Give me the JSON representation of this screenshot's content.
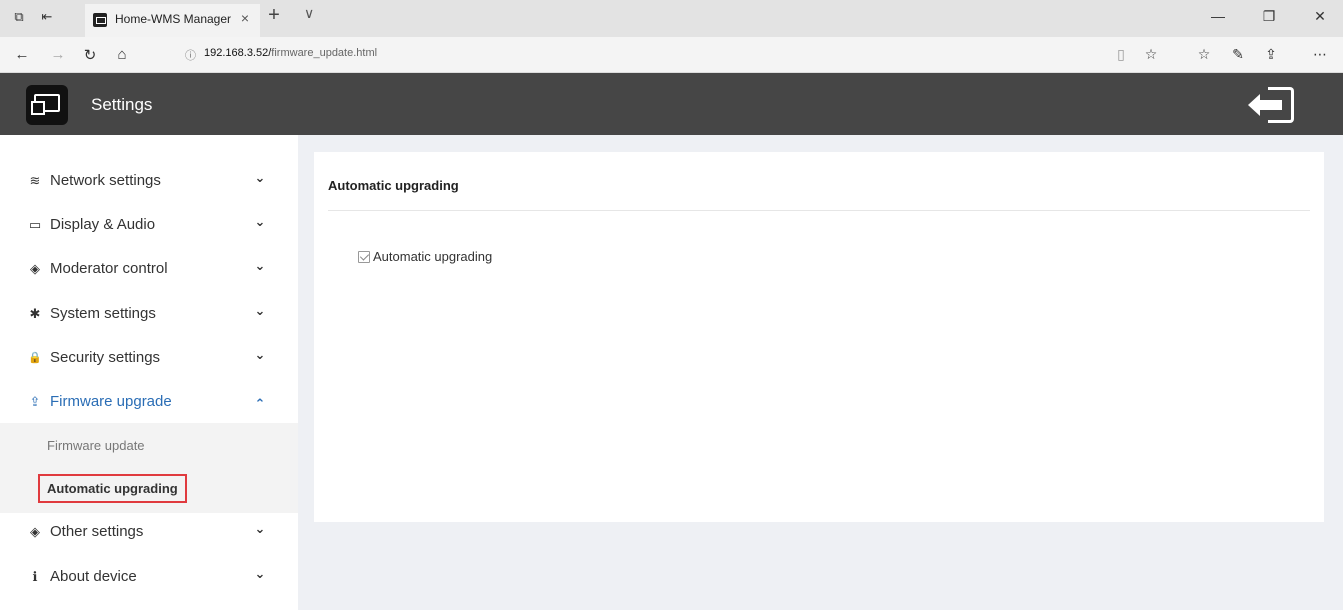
{
  "browser": {
    "tab_title": "Home-WMS Manager",
    "tab_close": "×",
    "new_tab": "+",
    "tab_list": "∨",
    "url_host": "192.168.3.52/",
    "url_path": "firmware_update.html",
    "window_controls": {
      "minimize": "—",
      "restore": "❐",
      "close": "✕"
    },
    "icons": [
      "tab-actions-icon",
      "set-aside-tabs-icon",
      "back-icon",
      "forward-icon",
      "refresh-icon",
      "home-icon",
      "site-info-icon",
      "reading-view-icon",
      "favorite-star-icon",
      "favorites-list-icon",
      "web-note-icon",
      "share-icon",
      "more-icon"
    ]
  },
  "header": {
    "title": "Settings",
    "logo_icon": "screen-mirror-icon",
    "logout_icon": "logout-icon"
  },
  "sidebar": {
    "items": [
      {
        "label": "Network settings",
        "icon": "wifi-icon",
        "glyph": "≋",
        "chevron": "⌄"
      },
      {
        "label": "Display & Audio",
        "icon": "monitor-icon",
        "glyph": "▭",
        "chevron": "⌄"
      },
      {
        "label": "Moderator control",
        "icon": "diamond-icon",
        "glyph": "◈",
        "chevron": "⌄"
      },
      {
        "label": "System settings",
        "icon": "gear-icon",
        "glyph": "✱",
        "chevron": "⌄"
      },
      {
        "label": "Security settings",
        "icon": "lock-icon",
        "glyph": "🔒",
        "chevron": "⌄"
      },
      {
        "label": "Firmware upgrade",
        "icon": "upload-icon",
        "glyph": "⇪",
        "chevron": "⌃"
      },
      {
        "label": "Other settings",
        "icon": "diamond-icon",
        "glyph": "◈",
        "chevron": "⌄"
      },
      {
        "label": "About device",
        "icon": "info-icon",
        "glyph": "ℹ",
        "chevron": "⌄"
      }
    ],
    "submenu": {
      "items": [
        "Firmware update",
        "Automatic upgrading"
      ],
      "selected": "Automatic upgrading"
    }
  },
  "main": {
    "card_title": "Automatic upgrading",
    "checkbox_label": "Automatic upgrading",
    "checkbox_checked": true
  },
  "colors": {
    "header_bg": "#464646",
    "active_accent": "#2a6db5",
    "selection_border": "#e03a3e",
    "content_bg": "#eef0f4"
  }
}
